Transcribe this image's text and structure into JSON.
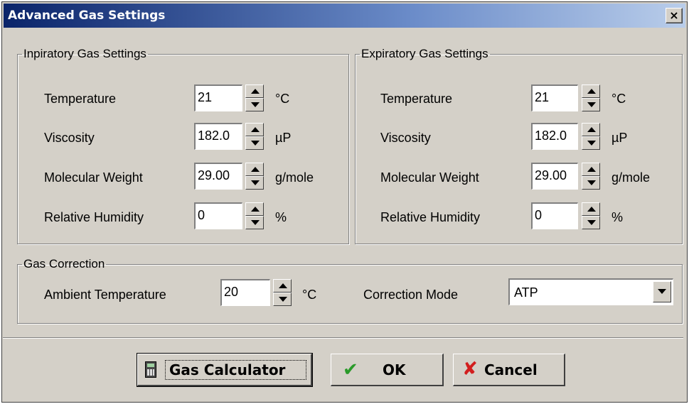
{
  "window": {
    "title": "Advanced Gas Settings",
    "close_label": "×"
  },
  "inspiratory": {
    "legend": "Inpiratory Gas Settings",
    "rows": [
      {
        "label": "Temperature",
        "value": "21",
        "unit": "°C"
      },
      {
        "label": "Viscosity",
        "value": "182.0",
        "unit": "µP"
      },
      {
        "label": "Molecular Weight",
        "value": "29.00",
        "unit": "g/mole"
      },
      {
        "label": "Relative Humidity",
        "value": "0",
        "unit": "%"
      }
    ]
  },
  "expiratory": {
    "legend": "Expiratory Gas Settings",
    "rows": [
      {
        "label": "Temperature",
        "value": "21",
        "unit": "°C"
      },
      {
        "label": "Viscosity",
        "value": "182.0",
        "unit": "µP"
      },
      {
        "label": "Molecular Weight",
        "value": "29.00",
        "unit": "g/mole"
      },
      {
        "label": "Relative Humidity",
        "value": "0",
        "unit": "%"
      }
    ]
  },
  "gas_correction": {
    "legend": "Gas Correction",
    "ambient_label": "Ambient Temperature",
    "ambient_value": "20",
    "ambient_unit": "°C",
    "mode_label": "Correction Mode",
    "mode_value": "ATP"
  },
  "buttons": {
    "gas_calculator": "Gas Calculator",
    "ok": "OK",
    "cancel": "Cancel"
  },
  "icons": {
    "calculator": "calculator-icon",
    "ok": "checkmark-icon",
    "cancel": "x-icon",
    "close": "close-icon"
  }
}
